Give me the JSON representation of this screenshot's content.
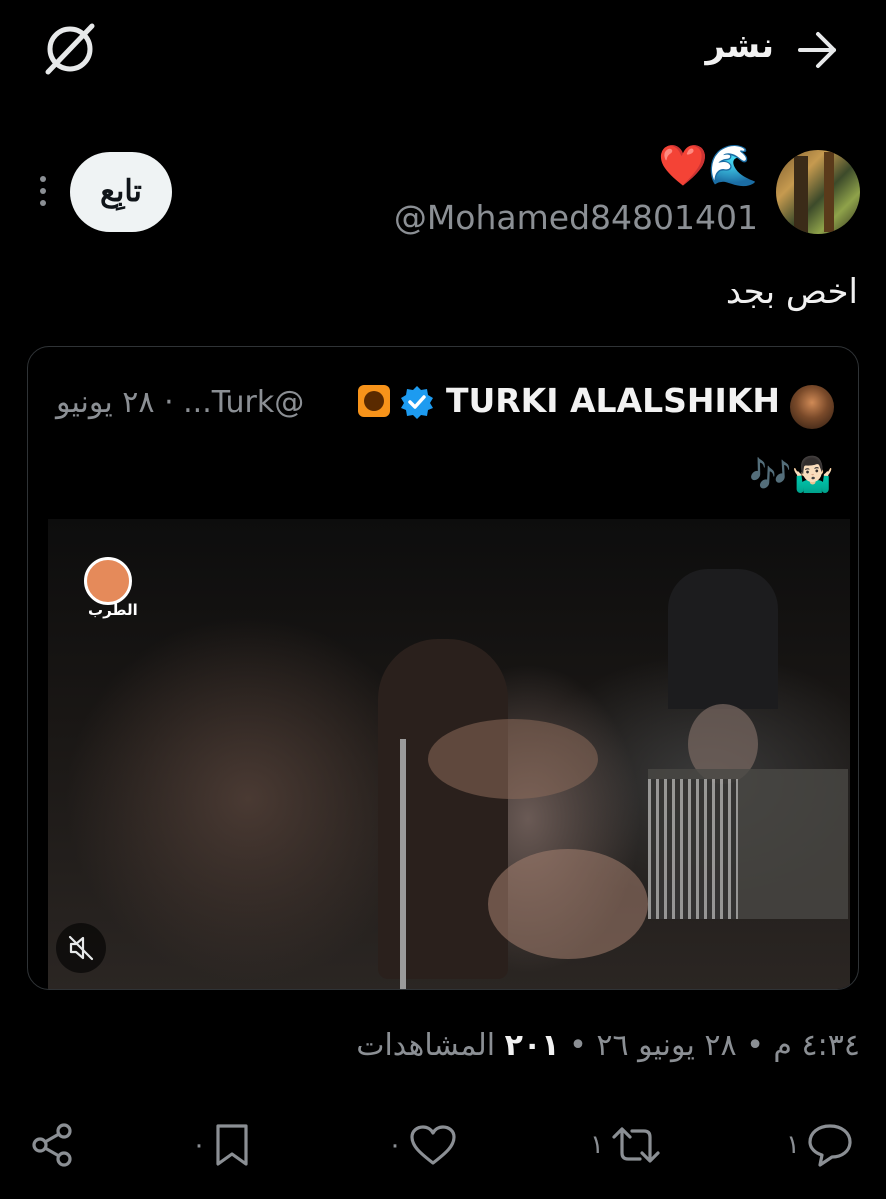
{
  "header": {
    "title": "نشر"
  },
  "author": {
    "display_name": "❤️🌊",
    "handle": "@Mohamed84801401"
  },
  "follow_button": {
    "label": "تابِع"
  },
  "post": {
    "text": "اخص بجد"
  },
  "quoted_tweet": {
    "display_name": "TURKI ALALSHIKH",
    "handle_date": "@Turk... · ٢٨ يونيو",
    "text": "🤷🏻‍♂️🎶",
    "video": {
      "channel_logo_text": "الطرب"
    }
  },
  "meta": {
    "datetime": "٤:٣٤ م • ٢٨ يونيو ٢٦ •",
    "views_count": "٢٠١",
    "views_label": "المشاهدات"
  },
  "actions": {
    "reply_count": "١",
    "retweet_count": "١",
    "like_count": "٠",
    "bookmark_count": "٠"
  },
  "colors": {
    "background": "#000000",
    "text_primary": "#e7e9ea",
    "text_secondary": "#8b8f94",
    "verified_blue": "#1d9bf0",
    "follow_button_bg": "#eff3f4"
  }
}
